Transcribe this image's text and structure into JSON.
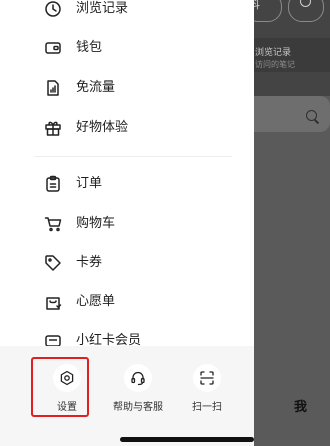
{
  "background": {
    "top_pill_text": "抖",
    "card_title": "浏览记录",
    "card_subtitle": "访问的笔记",
    "me_tab_label": "我"
  },
  "menu": {
    "items": [
      {
        "label": "浏览记录",
        "icon": "clock-icon"
      },
      {
        "label": "钱包",
        "icon": "wallet-icon"
      },
      {
        "label": "免流量",
        "icon": "data-signal-icon"
      },
      {
        "label": "好物体验",
        "icon": "gift-icon"
      },
      {
        "label": "订单",
        "icon": "clipboard-icon"
      },
      {
        "label": "购物车",
        "icon": "cart-icon"
      },
      {
        "label": "卡券",
        "icon": "tag-icon"
      },
      {
        "label": "心愿单",
        "icon": "wishlist-bag-icon"
      },
      {
        "label": "小红卡会员",
        "icon": "member-card-icon"
      }
    ]
  },
  "bottom_bar": {
    "settings_label": "设置",
    "help_label": "帮助与客服",
    "scan_label": "扫一扫"
  },
  "colors": {
    "highlight_border": "#e02020",
    "backdrop": "#5a5a5a"
  }
}
